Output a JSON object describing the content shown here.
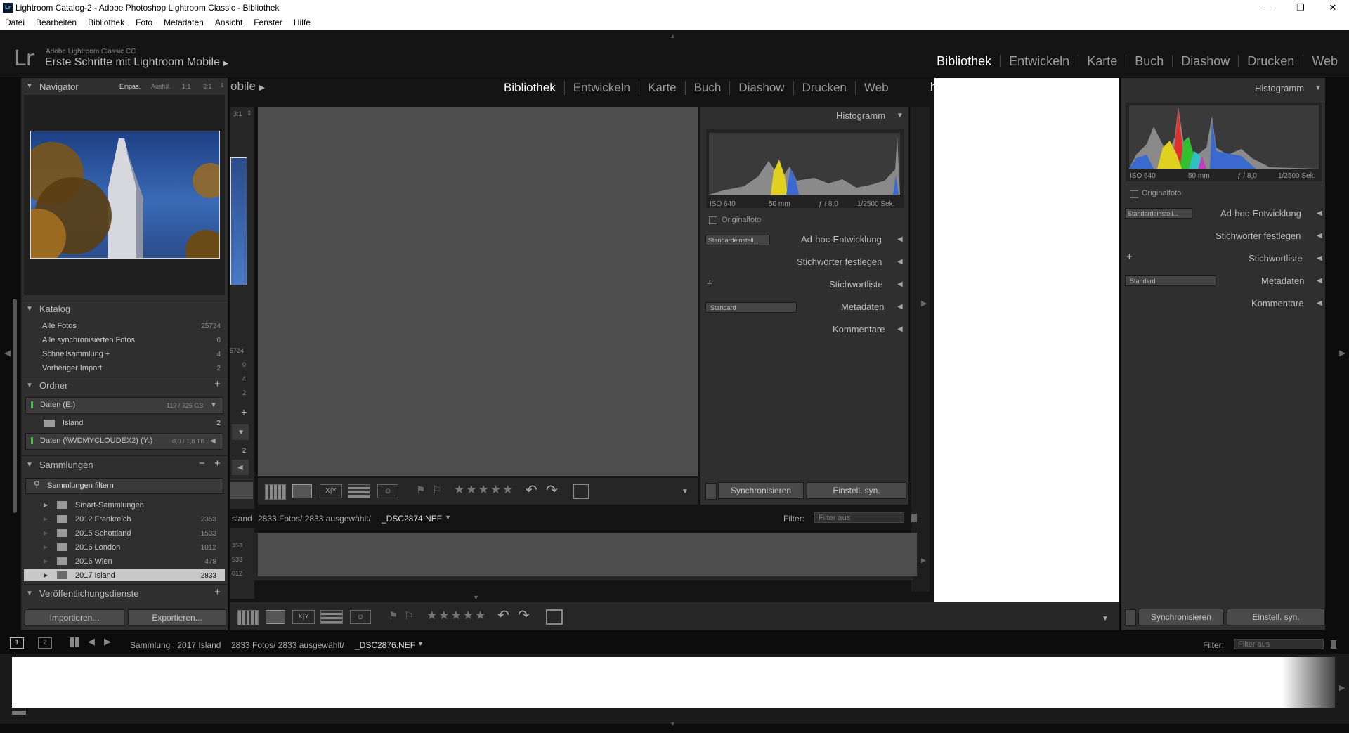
{
  "titlebar": {
    "title": "Lightroom Catalog-2 - Adobe Photoshop Lightroom Classic - Bibliothek",
    "icon": "Lr",
    "minimize": "—",
    "maximize": "❐",
    "close": "✕"
  },
  "menu": [
    "Datei",
    "Bearbeiten",
    "Bibliothek",
    "Foto",
    "Metadaten",
    "Ansicht",
    "Fenster",
    "Hilfe"
  ],
  "identity": {
    "logo": "Lr",
    "product": "Adobe Lightroom Classic CC",
    "subtitle": "Erste Schritte mit Lightroom Mobile",
    "arrow": "▶"
  },
  "modules": [
    "Bibliothek",
    "Entwickeln",
    "Karte",
    "Buch",
    "Diashow",
    "Drucken",
    "Web"
  ],
  "navigator": {
    "title": "Navigator",
    "zooms": [
      "Einpas.",
      "Ausfül.",
      "1:1",
      "3:1"
    ]
  },
  "catalog": {
    "title": "Katalog",
    "items": [
      {
        "label": "Alle Fotos",
        "count": "25724"
      },
      {
        "label": "Alle synchronisierten Fotos",
        "count": "0"
      },
      {
        "label": "Schnellsammlung  +",
        "count": "4"
      },
      {
        "label": "Vorheriger Import",
        "count": "2"
      }
    ]
  },
  "folders": {
    "title": "Ordner",
    "add": "+",
    "vol1": {
      "label": "Daten (E:)",
      "size": "119 / 326 GB"
    },
    "sub": {
      "label": "Island",
      "count": "2"
    },
    "vol2": {
      "label": "Daten (\\\\WDMYCLOUDEX2) (Y:)",
      "size": "0,0 / 1,8 TB"
    }
  },
  "collections": {
    "title": "Sammlungen",
    "minus": "−",
    "add": "+",
    "filter_placeholder": "Sammlungen filtern",
    "items": [
      {
        "label": "Smart-Sammlungen",
        "count": ""
      },
      {
        "label": "2012 Frankreich",
        "count": "2353"
      },
      {
        "label": "2015 Schottland",
        "count": "1533"
      },
      {
        "label": "2016 London",
        "count": "1012"
      },
      {
        "label": "2016 Wien",
        "count": "478"
      },
      {
        "label": "2017 Island",
        "count": "2833"
      }
    ]
  },
  "publish": {
    "title": "Veröffentlichungsdienste",
    "add": "+"
  },
  "left_buttons": {
    "import": "Importieren...",
    "export": "Exportieren..."
  },
  "right_panel": {
    "histogram": "Histogramm",
    "iso": "ISO 640",
    "focal": "50 mm",
    "aperture": "ƒ / 8,0",
    "shutter": "1/2500 Sek.",
    "original": "Originalfoto",
    "quick_develop": "Ad-hoc-Entwicklung",
    "preset": "Standardeinstell...",
    "keywording": "Stichwörter festlegen",
    "keyword_list": "Stichwortliste",
    "plus": "+",
    "metadata": "Metadaten",
    "metadata_preset": "Standard",
    "comments": "Kommentare"
  },
  "sync": {
    "sync": "Synchronisieren",
    "settings": "Einstell. syn."
  },
  "filmstrip": {
    "page1": "1",
    "page2": "2",
    "source": "Sammlung : 2017 Island",
    "count": "2833 Fotos/ 2833 ausgewählt/",
    "file": "_DSC2876.NEF",
    "filter_label": "Filter:",
    "filter_value": "Filter aus"
  },
  "inner": {
    "modules": [
      "Bibliothek",
      "Entwickeln",
      "Karte",
      "Buch",
      "Diashow",
      "Drucken",
      "Web"
    ],
    "left_fragment": "obile",
    "zoom": "3:1",
    "stars": "★★★★★",
    "histogram": "Histogramm",
    "iso": "ISO 640",
    "focal": "50 mm",
    "aperture": "ƒ / 8,0",
    "shutter": "1/2500 Sek.",
    "original": "Originalfoto",
    "quick_develop": "Ad-hoc-Entwicklung",
    "preset": "Standardeinstell...",
    "keywording": "Stichwörter festlegen",
    "keyword_list": "Stichwortliste",
    "plus": "+",
    "metadata": "Metadaten",
    "metadata_preset": "Standard",
    "comments": "Kommentare",
    "sync": "Synchronisieren",
    "sync_settings": "Einstell. syn.",
    "source": "sland",
    "count": "2833 Fotos/ 2833 ausgewählt/",
    "file": "_DSC2874.NEF",
    "filter_label": "Filter:",
    "filter_value": "Filter aus",
    "counts": [
      "5724",
      "0",
      "4",
      "2"
    ],
    "counts2": [
      "353",
      "533",
      "012"
    ],
    "page": "2"
  },
  "toolbar": {
    "stars": "★★★★★"
  },
  "colors": {
    "background": "#141414",
    "panel": "#2f2f2f",
    "selected": "#c8c8c8"
  }
}
